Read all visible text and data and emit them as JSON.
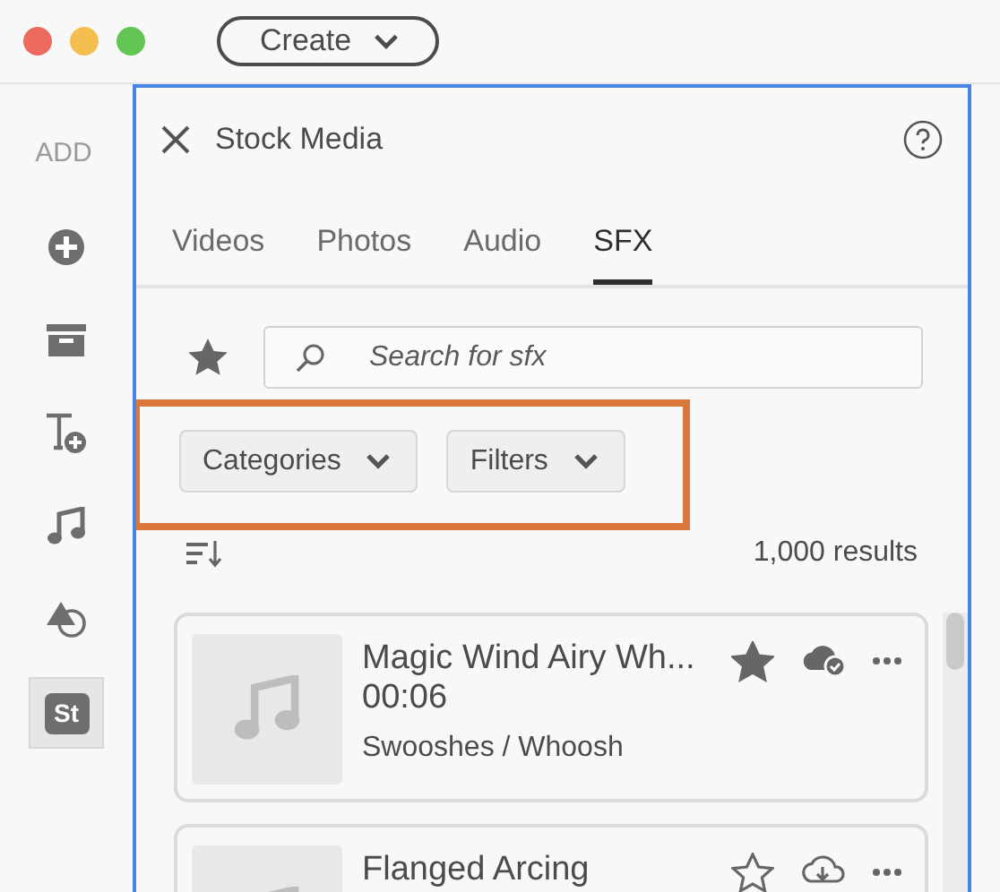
{
  "window": {
    "create_button": "Create"
  },
  "sidebar": {
    "heading": "ADD",
    "items": [
      {
        "kind": "add",
        "selected": false
      },
      {
        "kind": "library",
        "selected": false
      },
      {
        "kind": "text",
        "selected": false
      },
      {
        "kind": "audio",
        "selected": false
      },
      {
        "kind": "shapes",
        "selected": false
      },
      {
        "kind": "stock",
        "label": "St",
        "selected": true
      }
    ]
  },
  "panel": {
    "title": "Stock Media",
    "tabs": [
      {
        "label": "Videos",
        "selected": false
      },
      {
        "label": "Photos",
        "selected": false
      },
      {
        "label": "Audio",
        "selected": false
      },
      {
        "label": "SFX",
        "selected": true
      }
    ],
    "search": {
      "placeholder": "Search for sfx"
    },
    "filters": [
      "Categories",
      "Filters"
    ],
    "highlighted": true,
    "results_count": "1,000 results",
    "results": [
      {
        "title": "Magic Wind Airy Wh...",
        "duration": "00:06",
        "category": "Swooshes / Whoosh",
        "favorite": true,
        "downloaded": true
      },
      {
        "title": "Flanged Arcing",
        "favorite": false,
        "downloaded": false
      }
    ]
  }
}
